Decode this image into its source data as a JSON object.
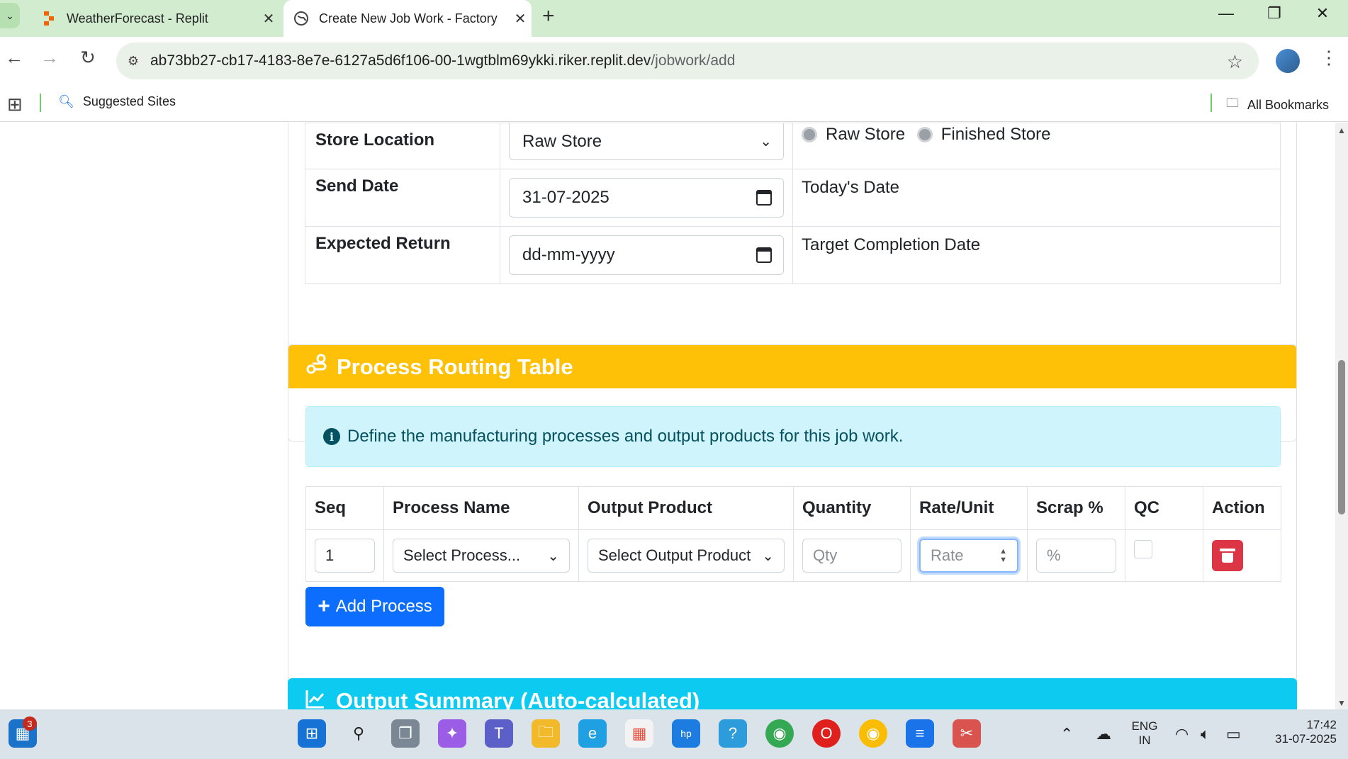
{
  "browser": {
    "tabs": [
      {
        "title": "WeatherForecast - Replit",
        "active": false
      },
      {
        "title": "Create New Job Work - Factory",
        "active": true
      }
    ],
    "new_tab_label": "+",
    "url_host": "ab73bb27-cb17-4183-8e7e-6127a5d6f106-00-1wgtblm69ykki.riker.replit.dev",
    "url_path": "/jobwork/add",
    "bookmarks": {
      "suggested": "Suggested Sites",
      "all": "All Bookmarks"
    }
  },
  "form": {
    "rows": [
      {
        "label": "Store Location",
        "value": "Raw Store",
        "hint_radios": [
          "Raw Store",
          "Finished Store"
        ]
      },
      {
        "label": "Send Date",
        "value": "31-07-2025",
        "hint": "Today's Date"
      },
      {
        "label": "Expected Return",
        "value": "dd-mm-yyyy",
        "hint": "Target Completion Date"
      }
    ]
  },
  "routing": {
    "header": "Process Routing Table",
    "info": "Define the manufacturing processes and output products for this job work.",
    "columns": [
      "Seq",
      "Process Name",
      "Output Product",
      "Quantity",
      "Rate/Unit",
      "Scrap %",
      "QC",
      "Action"
    ],
    "rows": [
      {
        "seq": "1",
        "process": "Select Process...",
        "product": "Select Output Product",
        "qty_ph": "Qty",
        "rate_ph": "Rate",
        "scrap_ph": "%",
        "qc": false
      }
    ],
    "add_button": "Add Process"
  },
  "summary": {
    "header": "Output Summary (Auto-calculated)"
  },
  "taskbar": {
    "notification_count": "3",
    "lang_line1": "ENG",
    "lang_line2": "IN",
    "time": "17:42",
    "date": "31-07-2025"
  },
  "colors": {
    "warning": "#ffc107",
    "info": "#0dcaf0",
    "primary": "#0d6efd",
    "danger": "#dc3545"
  }
}
